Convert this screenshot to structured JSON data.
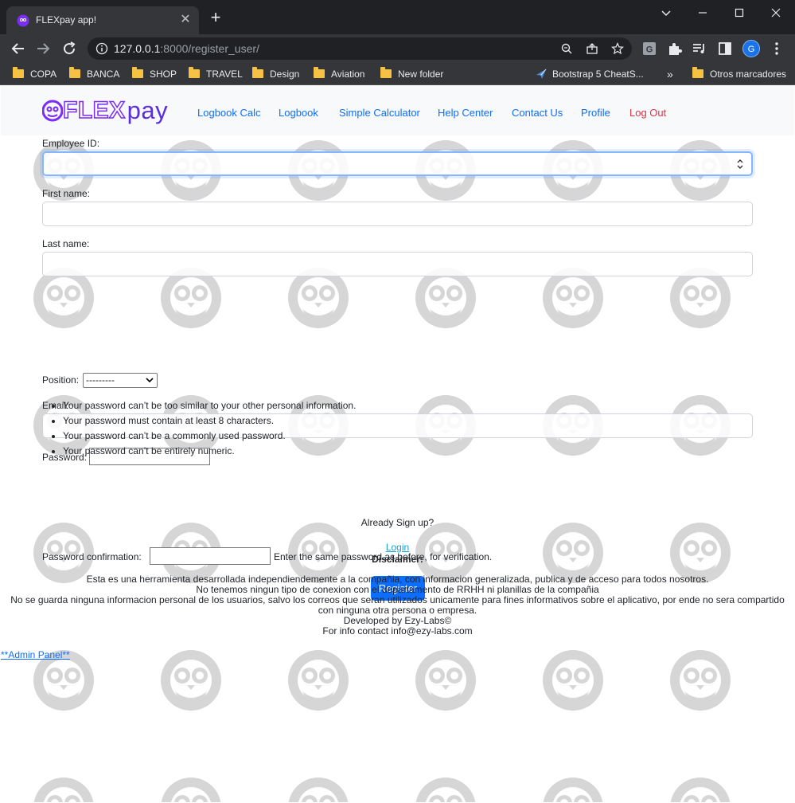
{
  "browser": {
    "tab_title": "FLEXpay app!",
    "url_host": "127.0.0.1",
    "url_rest": ":8000/register_user/",
    "profile_initial": "G",
    "bookmarks": [
      "COPA",
      "BANCA",
      "SHOP",
      "TRAVEL",
      "Design",
      "Aviation",
      "New folder",
      "Bootstrap 5 CheatS...",
      "Otros marcadores"
    ],
    "more_bookmarks": "»"
  },
  "navbar": {
    "brand_flex": "FLEX",
    "brand_pay": "pay",
    "links": [
      "Logbook Calc",
      "Logbook",
      "Simple Calculator",
      "Help Center",
      "Contact Us",
      "Profile",
      "Log Out"
    ]
  },
  "form": {
    "employee_id_label": "Employee ID:",
    "first_name_label": "First name:",
    "last_name_label": "Last name:",
    "position_label": "Position:",
    "position_selected": "---------",
    "email_label": "Email:",
    "password_label": "Password:",
    "password_help": [
      "Your password can’t be too similar to your other personal information.",
      "Your password must contain at least 8 characters.",
      "Your password can’t be a commonly used password.",
      "Your password can’t be entirely numeric."
    ],
    "password_confirm_label": "Password confirmation:",
    "password_confirm_help": "Enter the same password as before, for verification.",
    "register_button": "Register",
    "already_signed": "Already Sign up?",
    "login_link": "Login"
  },
  "footer": {
    "disclaimer_title": "Disclaimer:",
    "lines": [
      "Esta es una herramienta desarrollada independiendemente a la compañia, con informacion generalizada, publica y de acceso para todos nosotros.",
      "No tenemos ningun tipo de conexion con el departamento de RRHH ni planillas de la compañia",
      "No se guarda ninguna informacion personal de los usuarios, salvo los correos que seran utilizados unicamente para fines informativos sobre el aplicativo, por ende no sera compartido con ninguna otra persona o empresa.",
      "Developed by Ezy-Labs©",
      "For info contact info@ezy-labs.com"
    ],
    "admin_link": "**Admin Panel**"
  },
  "colors": {
    "link": "#0d6efd",
    "logout": "#dc3545",
    "brand": "#5b2ee0",
    "primary_button": "#0d6efd"
  }
}
